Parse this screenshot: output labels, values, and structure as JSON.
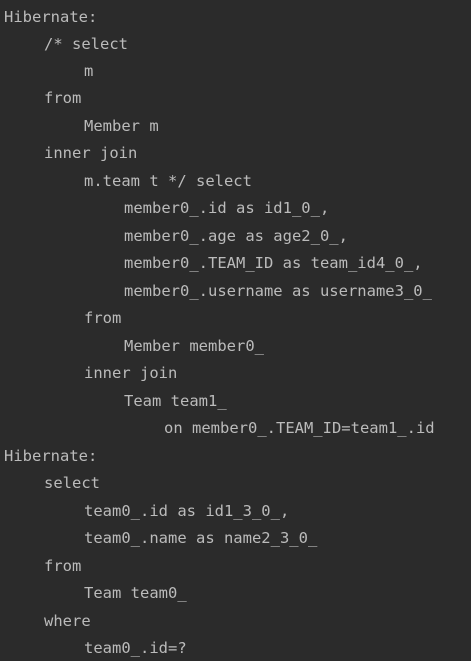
{
  "console": {
    "lines": [
      {
        "indent": 0,
        "text": "Hibernate:"
      },
      {
        "indent": 1,
        "text": "/* select"
      },
      {
        "indent": 2,
        "text": "m"
      },
      {
        "indent": 1,
        "text": "from"
      },
      {
        "indent": 2,
        "text": "Member m"
      },
      {
        "indent": 1,
        "text": "inner join"
      },
      {
        "indent": 2,
        "text": "m.team t */ select"
      },
      {
        "indent": 3,
        "text": "member0_.id as id1_0_,"
      },
      {
        "indent": 3,
        "text": "member0_.age as age2_0_,"
      },
      {
        "indent": 3,
        "text": "member0_.TEAM_ID as team_id4_0_,"
      },
      {
        "indent": 3,
        "text": "member0_.username as username3_0_"
      },
      {
        "indent": 2,
        "text": "from"
      },
      {
        "indent": 3,
        "text": "Member member0_"
      },
      {
        "indent": 2,
        "text": "inner join"
      },
      {
        "indent": 3,
        "text": "Team team1_"
      },
      {
        "indent": 4,
        "text": "on member0_.TEAM_ID=team1_.id"
      },
      {
        "indent": 0,
        "text": "Hibernate:"
      },
      {
        "indent": 1,
        "text": "select"
      },
      {
        "indent": 2,
        "text": "team0_.id as id1_3_0_,"
      },
      {
        "indent": 2,
        "text": "team0_.name as name2_3_0_"
      },
      {
        "indent": 1,
        "text": "from"
      },
      {
        "indent": 2,
        "text": "Team team0_"
      },
      {
        "indent": 1,
        "text": "where"
      },
      {
        "indent": 2,
        "text": "team0_.id=?"
      }
    ]
  }
}
